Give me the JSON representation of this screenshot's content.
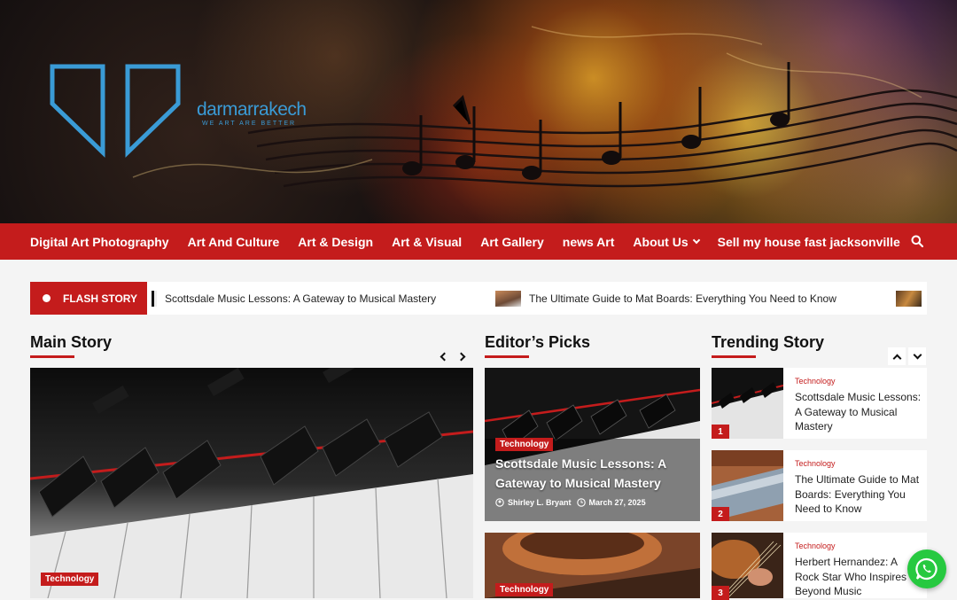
{
  "site": {
    "name": "darmarrakech",
    "tagline": "WE ART ARE BETTER"
  },
  "nav": {
    "items": [
      {
        "label": "Digital Art Photography"
      },
      {
        "label": "Art And Culture"
      },
      {
        "label": "Art & Design"
      },
      {
        "label": "Art & Visual"
      },
      {
        "label": "Art Gallery"
      },
      {
        "label": "news Art"
      },
      {
        "label": "About Us",
        "has_dropdown": true
      },
      {
        "label": "Sell my house fast jacksonville"
      }
    ],
    "search_icon": "search-icon"
  },
  "flash": {
    "label": "FLASH STORY",
    "items": [
      "Scottsdale Music Lessons: A Gateway to Musical Mastery",
      "The Ultimate Guide to Mat Boards: Everything You Need to Know"
    ]
  },
  "main_story": {
    "title": "Main Story",
    "tag": "Technology"
  },
  "editors_picks": {
    "title": "Editor’s Picks",
    "cards": [
      {
        "tag": "Technology",
        "title": "Scottsdale Music Lessons: A Gateway to Musical Mastery",
        "author": "Shirley L. Bryant",
        "date": "March 27, 2025"
      },
      {
        "tag": "Technology"
      }
    ]
  },
  "trending": {
    "title": "Trending Story",
    "items": [
      {
        "num": "1",
        "category": "Technology",
        "title": "Scottsdale Music Lessons: A Gateway to Musical Mastery"
      },
      {
        "num": "2",
        "category": "Technology",
        "title": "The Ultimate Guide to Mat Boards: Everything You Need to Know"
      },
      {
        "num": "3",
        "category": "Technology",
        "title": "Herbert Hernandez: A Rock Star Who Inspires Beyond Music"
      }
    ]
  },
  "colors": {
    "accent": "#c41c1c",
    "logo": "#3a9bd6",
    "whatsapp": "#27c940"
  }
}
